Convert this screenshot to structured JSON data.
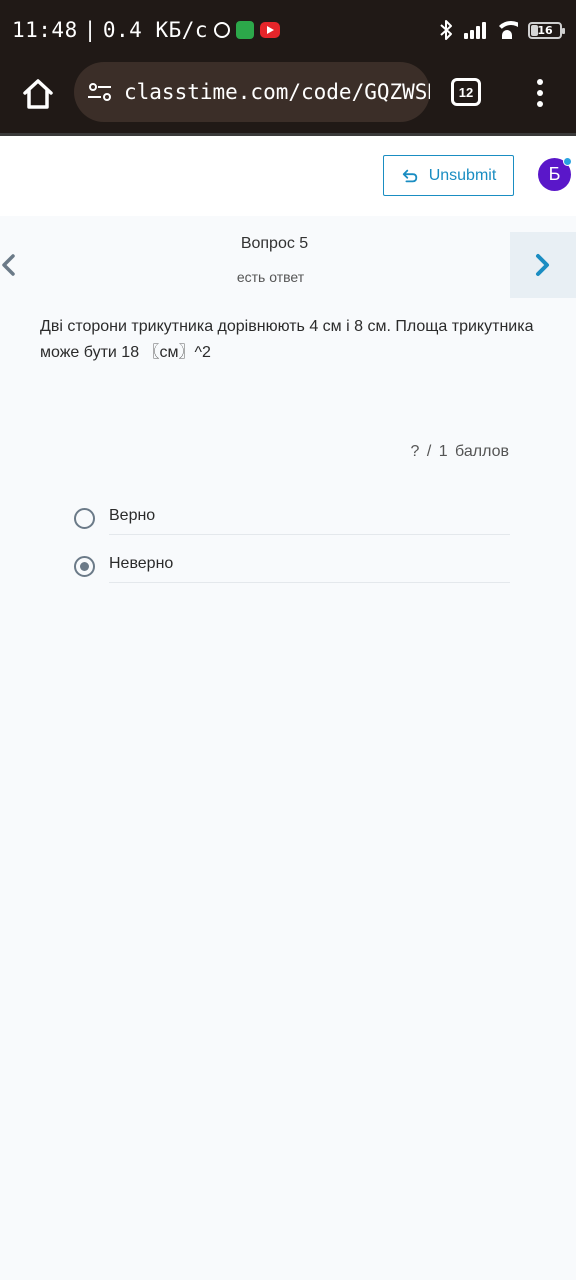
{
  "status_bar": {
    "time": "11:48",
    "speed": "0.4 КБ/с",
    "battery": "16"
  },
  "browser": {
    "url": "classtime.com/code/GQZWSD",
    "tab_count": "12"
  },
  "header": {
    "unsubmit_label": "Unsubmit",
    "avatar_letter": "Б"
  },
  "question": {
    "title": "Вопрос 5",
    "status": "есть ответ",
    "text": "Дві сторони трикутника дорівнюють 4 см і 8 см. Площа трикутника може бути 18 〖см〗^2",
    "score": "? / 1 баллов",
    "options": [
      {
        "label": "Верно",
        "selected": false
      },
      {
        "label": "Неверно",
        "selected": true
      }
    ]
  },
  "colors": {
    "accent": "#1a8dc2",
    "avatar": "#5a17c9",
    "browser_bg": "#201916"
  }
}
